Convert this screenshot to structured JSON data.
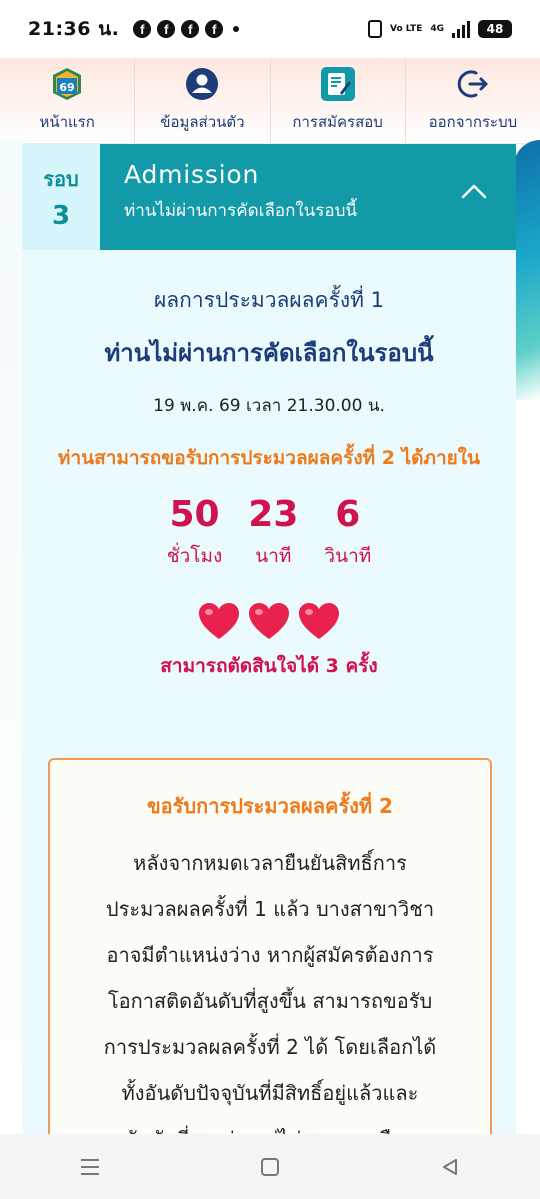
{
  "status_bar": {
    "time": "21:36 น.",
    "fb_glyph": "f",
    "volte": "Vo LTE",
    "network": "4G",
    "battery": "48"
  },
  "navbar": {
    "items": [
      {
        "label": "หน้าแรก",
        "icon": "tcas69-logo-icon",
        "logo_digits": "69"
      },
      {
        "label": "ข้อมูลส่วนตัว",
        "icon": "user-profile-icon"
      },
      {
        "label": "การสมัครสอบ",
        "icon": "application-form-icon"
      },
      {
        "label": "ออกจากระบบ",
        "icon": "logout-icon"
      }
    ]
  },
  "round": {
    "word": "รอบ",
    "number": "3",
    "title": "Admission",
    "subtitle": "ท่านไม่ผ่านการคัดเลือกในรอบนี้"
  },
  "result": {
    "label": "ผลการประมวลผลครั้งที่ 1",
    "status": "ท่านไม่ผ่านการคัดเลือกในรอบนี้",
    "datetime": "19 พ.ค. 69 เวลา 21.30.00 น.",
    "appeal_notice": "ท่านสามารถขอรับการประมวลผลครั้งที่ 2 ได้ภายใน"
  },
  "countdown": {
    "hours": "50",
    "hours_label": "ชั่วโมง",
    "minutes": "23",
    "minutes_label": "นาที",
    "seconds": "6",
    "seconds_label": "วินาที"
  },
  "decisions": {
    "hearts_remaining": 3,
    "text": "สามารถตัดสินใจได้ 3 ครั้ง"
  },
  "appeal_box": {
    "title": "ขอรับการประมวลผลครั้งที่ 2",
    "lines": [
      "หลังจากหมดเวลายืนยันสิทธิ์การ",
      "ประมวลผลครั้งที่ 1 แล้ว บางสาขาวิชา",
      "อาจมีตำแหน่งว่าง หากผู้สมัครต้องการ",
      "โอกาสติดอันดับที่สูงขึ้น สามารถขอรับ",
      "การประมวลผลครั้งที่ 2 ได้ โดยเลือกได้",
      "ทั้งอันดับปัจจุบันที่มีสิทธิ์อยู่แล้วและ",
      "อันดับที่สูงกว่า แต่ไม่สามารถเลือก"
    ]
  },
  "colors": {
    "teal": "#129aa8",
    "navy": "#1d3d7a",
    "orange": "#ee7a1c",
    "crimson": "#d0124f"
  }
}
